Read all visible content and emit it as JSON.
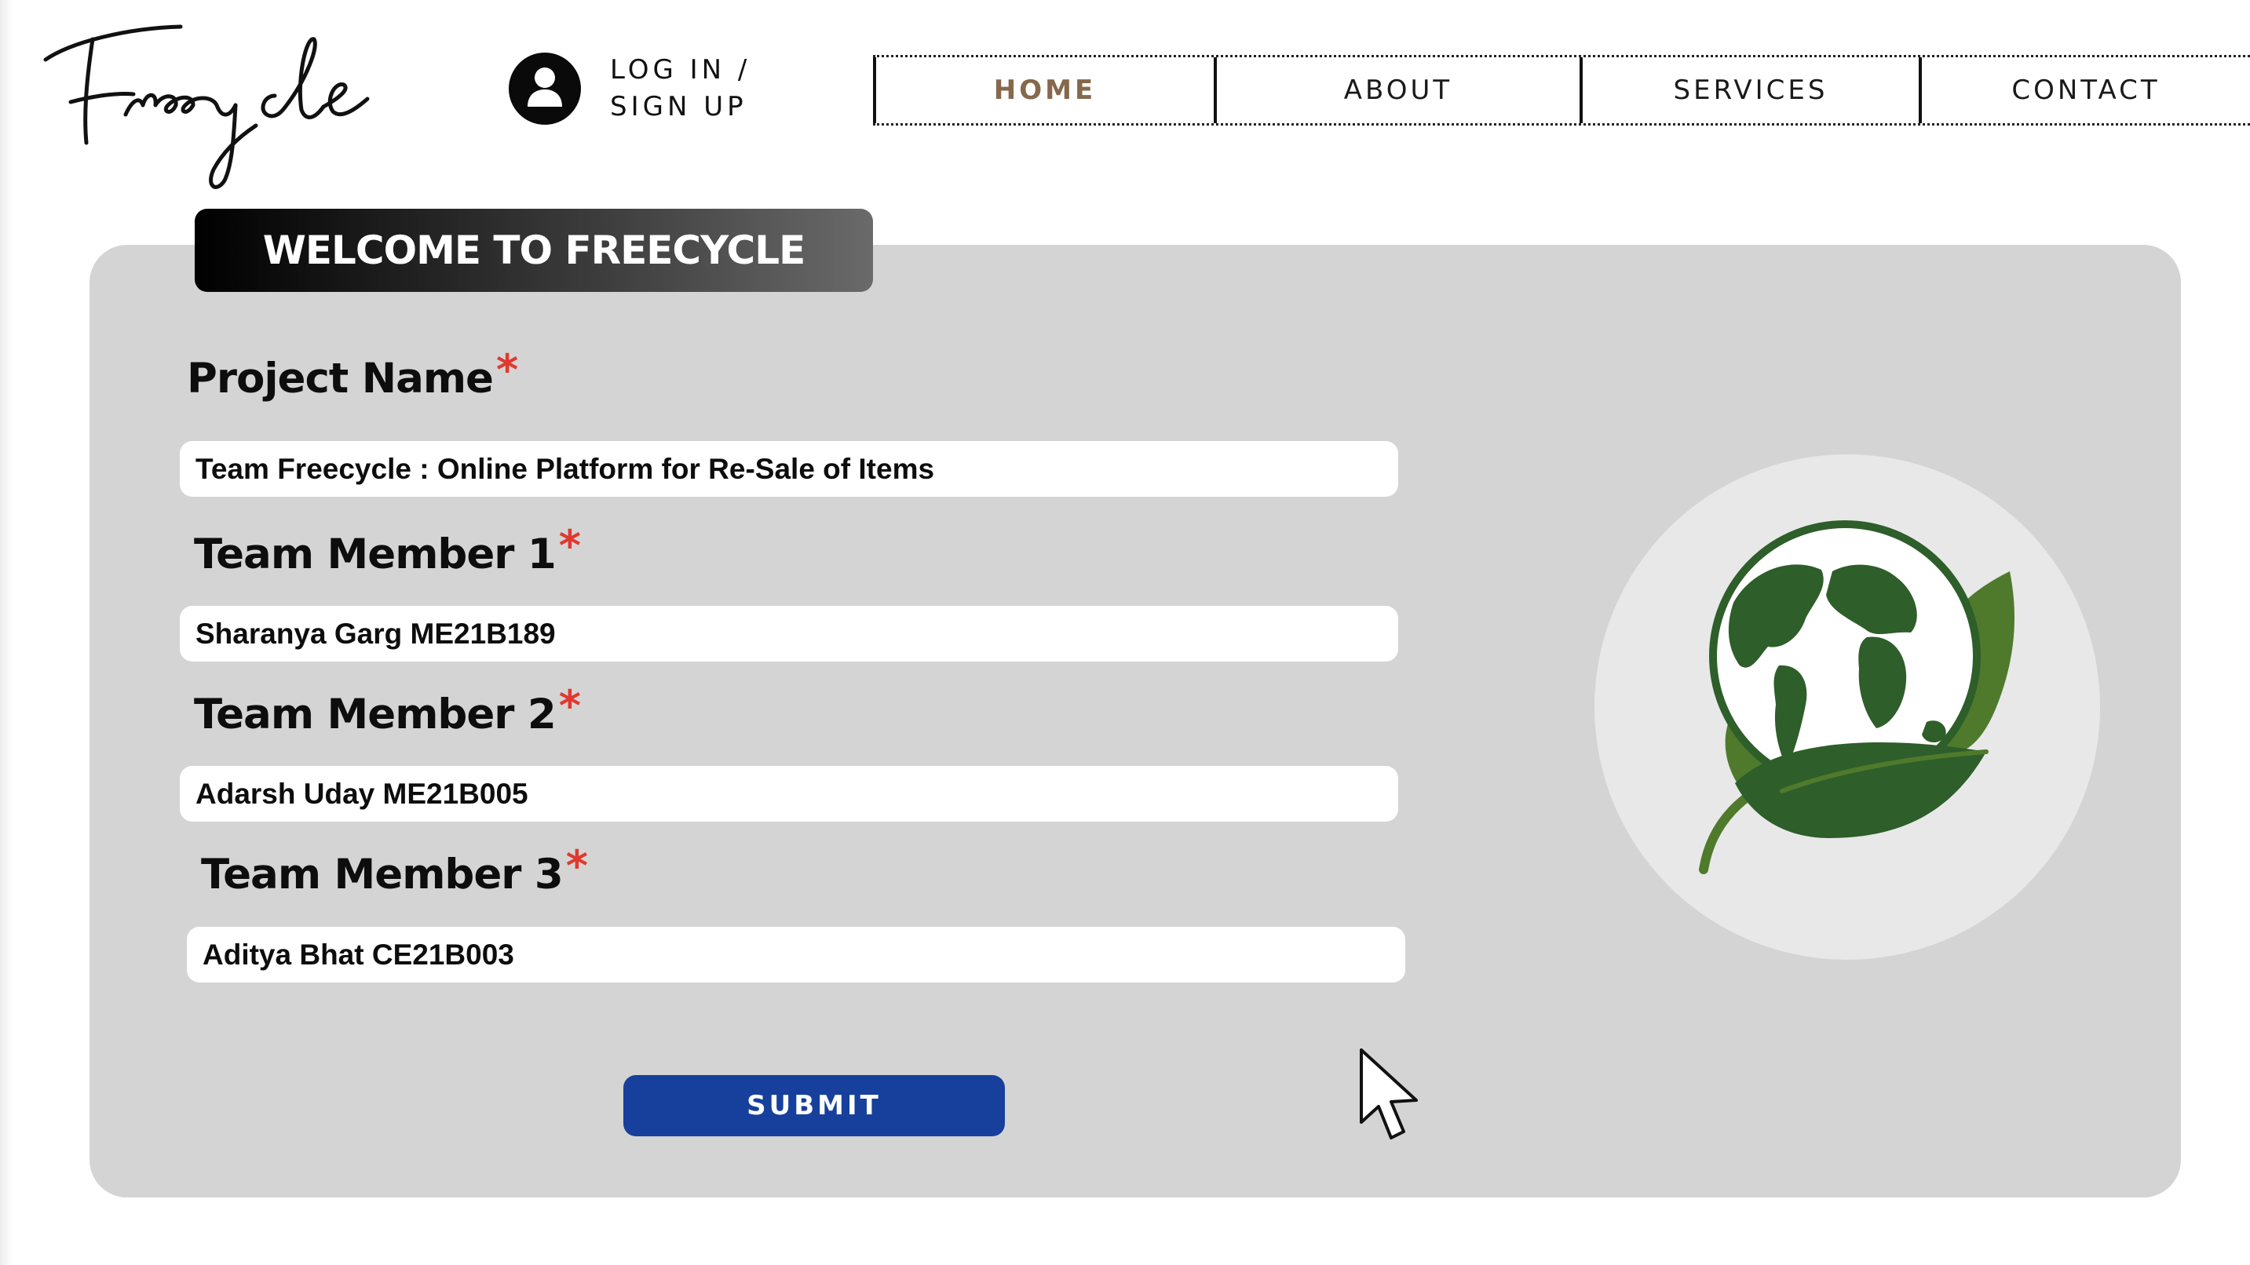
{
  "header": {
    "logo_text": "Freecycle",
    "account": {
      "line1": "LOG IN /",
      "line2": "SIGN UP"
    },
    "nav": [
      {
        "label": "HOME",
        "active": true
      },
      {
        "label": "ABOUT",
        "active": false
      },
      {
        "label": "SERVICES",
        "active": false
      },
      {
        "label": "CONTACT",
        "active": false
      }
    ]
  },
  "main": {
    "banner_title": "WELCOME TO FREECYCLE",
    "required_mark": "*",
    "fields": [
      {
        "label": "Project Name",
        "value": "Team Freecycle : Online Platform for Re-Sale of Items"
      },
      {
        "label": "Team Member 1",
        "value": "Sharanya Garg ME21B189"
      },
      {
        "label": "Team Member 2",
        "value": "Adarsh Uday ME21B005"
      },
      {
        "label": "Team Member 3",
        "value": "Aditya Bhat CE21B003"
      }
    ],
    "submit_label": "SUBMIT"
  },
  "colors": {
    "panel": "#d4d4d4",
    "submit": "#16409c",
    "nav_active": "#86684c",
    "required": "#e0392f",
    "leaf_dark": "#2e5e2a",
    "leaf_light": "#4f7a2c"
  },
  "icons": [
    "user-icon",
    "earth-leaf-logo",
    "mouse-pointer-icon"
  ]
}
